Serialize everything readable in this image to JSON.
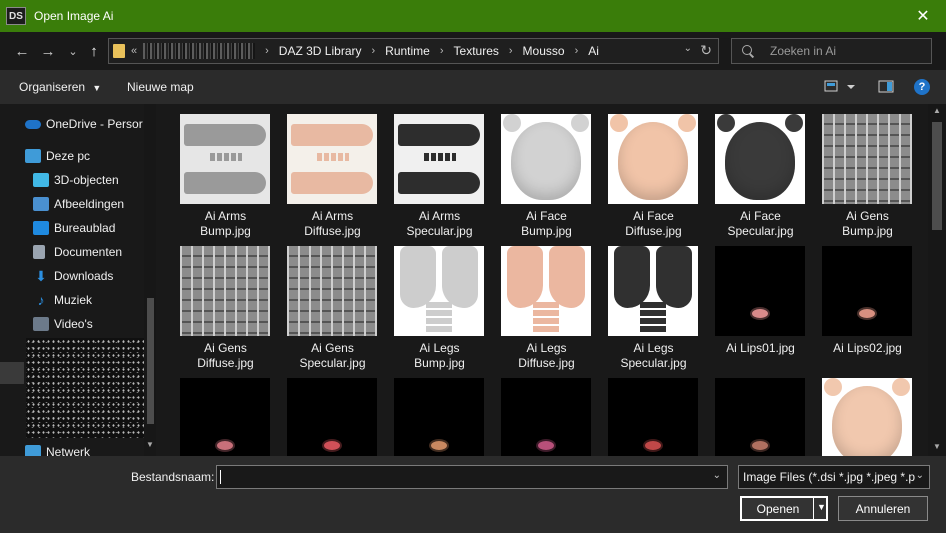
{
  "window": {
    "app_icon_text": "DS",
    "title": "Open Image Ai",
    "close_glyph": "✕"
  },
  "nav": {
    "back_icon": "←",
    "forward_icon": "→",
    "recent_icon": "⌄",
    "up_icon": "↑",
    "overflow": "«",
    "breadcrumbs": [
      "DAZ 3D Library",
      "Runtime",
      "Textures",
      "Mousso",
      "Ai"
    ],
    "breadcrumb_sep": "›",
    "search_placeholder": "Zoeken in Ai"
  },
  "toolbar": {
    "organize_label": "Organiseren",
    "new_folder_label": "Nieuwe map",
    "help_label": "?"
  },
  "sidebar": {
    "items": [
      {
        "label": "OneDrive - Persor",
        "icon": "cloud-icon",
        "color": "#1f73c8"
      },
      {
        "label": "Deze pc",
        "icon": "computer-icon",
        "color": "#3f9bd8"
      },
      {
        "label": "3D-objecten",
        "icon": "cube-icon",
        "color": "#41b8e6"
      },
      {
        "label": "Afbeeldingen",
        "icon": "pictures-icon",
        "color": "#4a90d0"
      },
      {
        "label": "Bureaublad",
        "icon": "desktop-icon",
        "color": "#1f8ae0"
      },
      {
        "label": "Documenten",
        "icon": "documents-icon",
        "color": "#9aa4b0"
      },
      {
        "label": "Downloads",
        "icon": "download-icon",
        "color": "#2b8fe0"
      },
      {
        "label": "Muziek",
        "icon": "music-icon",
        "color": "#2b8fe0"
      },
      {
        "label": "Video's",
        "icon": "video-icon",
        "color": "#6c7a8a"
      },
      {
        "label": "Netwerk",
        "icon": "network-icon",
        "color": "#3f9bd8"
      }
    ]
  },
  "files": [
    {
      "label": "Ai Arms\nBump.jpg",
      "kind": "arms",
      "tone": "#e6e6e6",
      "fg": "#9a9a9a"
    },
    {
      "label": "Ai Arms\nDiffuse.jpg",
      "kind": "arms",
      "tone": "#f4f0ea",
      "fg": "#e8b9a2"
    },
    {
      "label": "Ai Arms\nSpecular.jpg",
      "kind": "arms",
      "tone": "#f0f0f0",
      "fg": "#2d2d2d"
    },
    {
      "label": "Ai Face\nBump.jpg",
      "kind": "face",
      "tone": "#ffffff",
      "fg": "#d2d2d2"
    },
    {
      "label": "Ai Face\nDiffuse.jpg",
      "kind": "face",
      "tone": "#ffffff",
      "fg": "#f1c4a8"
    },
    {
      "label": "Ai Face\nSpecular.jpg",
      "kind": "face",
      "tone": "#ffffff",
      "fg": "#3a3a3a"
    },
    {
      "label": "Ai Gens\nBump.jpg",
      "kind": "gens",
      "tone": "#8c8c8c",
      "fg": "#cfcfcf"
    },
    {
      "label": "Ai Gens\nDiffuse.jpg",
      "kind": "gens",
      "tone": "#8c8c8c",
      "fg": "#cfcfcf"
    },
    {
      "label": "Ai Gens\nSpecular.jpg",
      "kind": "gens",
      "tone": "#8c8c8c",
      "fg": "#cfcfcf"
    },
    {
      "label": "Ai Legs\nBump.jpg",
      "kind": "legs",
      "tone": "#ffffff",
      "fg": "#cdcdcd"
    },
    {
      "label": "Ai Legs\nDiffuse.jpg",
      "kind": "legs",
      "tone": "#ffffff",
      "fg": "#ebb7a0"
    },
    {
      "label": "Ai Legs\nSpecular.jpg",
      "kind": "legs",
      "tone": "#ffffff",
      "fg": "#303030"
    },
    {
      "label": "Ai Lips01.jpg",
      "kind": "lips",
      "tone": "#000000",
      "fg": "#d98a8a"
    },
    {
      "label": "Ai Lips02.jpg",
      "kind": "lips",
      "tone": "#000000",
      "fg": "#d99080"
    },
    {
      "label": "",
      "kind": "lips",
      "tone": "#000000",
      "fg": "#c8707a"
    },
    {
      "label": "",
      "kind": "lips",
      "tone": "#000000",
      "fg": "#d05058"
    },
    {
      "label": "",
      "kind": "lips",
      "tone": "#000000",
      "fg": "#c88860"
    },
    {
      "label": "",
      "kind": "lips",
      "tone": "#000000",
      "fg": "#b8507a"
    },
    {
      "label": "",
      "kind": "lips",
      "tone": "#000000",
      "fg": "#c04848"
    },
    {
      "label": "",
      "kind": "lips",
      "tone": "#000000",
      "fg": "#b07060"
    },
    {
      "label": "",
      "kind": "face",
      "tone": "#ffffff",
      "fg": "#f1c8ae"
    }
  ],
  "footer": {
    "filename_label": "Bestandsnaam:",
    "filename_value": "",
    "filter_value": "Image Files (*.dsi *.jpg *.jpeg *.p",
    "open_label": "Openen",
    "cancel_label": "Annuleren"
  }
}
